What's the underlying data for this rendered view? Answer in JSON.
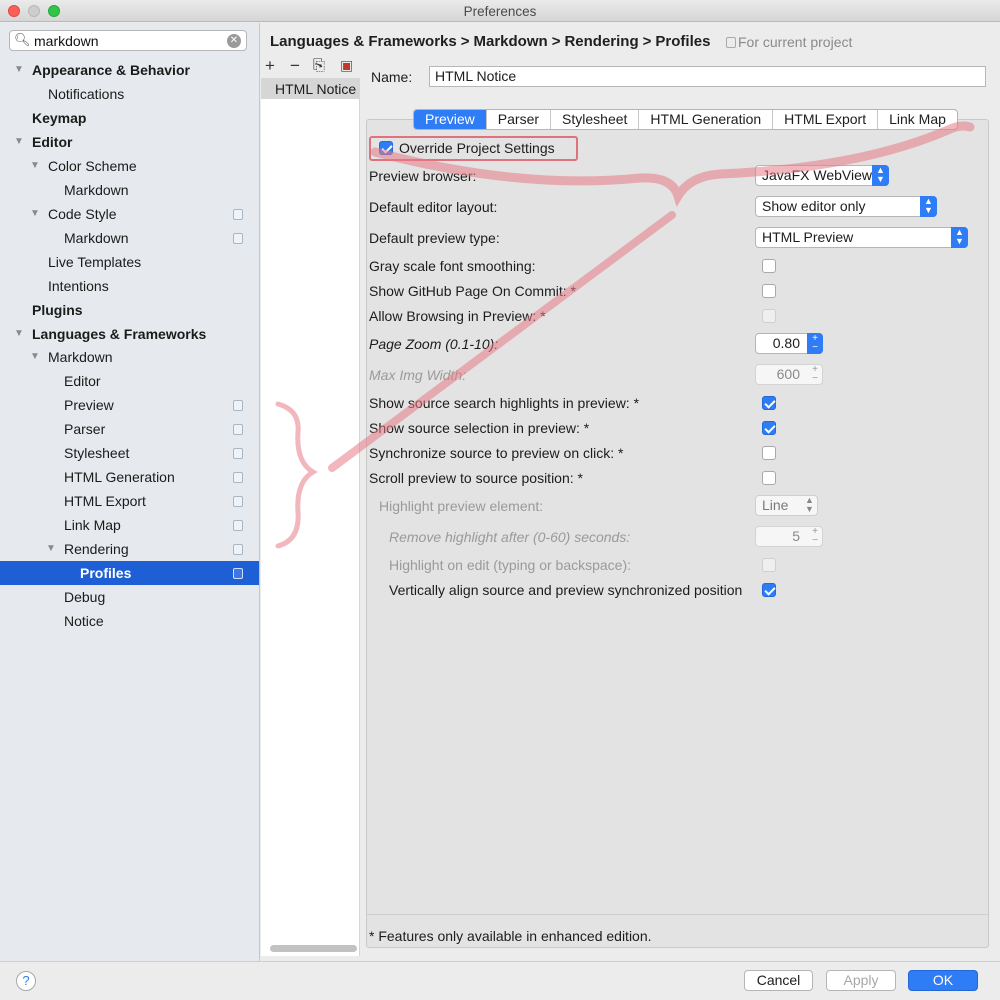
{
  "window": {
    "title": "Preferences"
  },
  "search": {
    "value": "markdown"
  },
  "sidebar": {
    "items": [
      {
        "label": "Appearance & Behavior"
      },
      {
        "label": "Notifications"
      },
      {
        "label": "Keymap"
      },
      {
        "label": "Editor"
      },
      {
        "label": "Color Scheme"
      },
      {
        "label": "Markdown"
      },
      {
        "label": "Code Style"
      },
      {
        "label": "Markdown"
      },
      {
        "label": "Live Templates"
      },
      {
        "label": "Intentions"
      },
      {
        "label": "Plugins"
      },
      {
        "label": "Languages & Frameworks"
      },
      {
        "label": "Markdown"
      },
      {
        "label": "Editor"
      },
      {
        "label": "Preview"
      },
      {
        "label": "Parser"
      },
      {
        "label": "Stylesheet"
      },
      {
        "label": "HTML Generation"
      },
      {
        "label": "HTML Export"
      },
      {
        "label": "Link Map"
      },
      {
        "label": "Rendering"
      },
      {
        "label": "Profiles"
      },
      {
        "label": "Debug"
      },
      {
        "label": "Notice"
      }
    ]
  },
  "breadcrumb": {
    "parts": [
      "Languages & Frameworks",
      "Markdown",
      "Rendering",
      "Profiles"
    ],
    "separator": ">",
    "scope_note": "For current project"
  },
  "profiles": {
    "items": [
      "HTML Notice"
    ]
  },
  "name": {
    "label": "Name:",
    "value": "HTML Notice"
  },
  "tabs": [
    "Preview",
    "Parser",
    "Stylesheet",
    "HTML Generation",
    "HTML Export",
    "Link Map"
  ],
  "active_tab": "Preview",
  "settings": {
    "override": {
      "label": "Override Project Settings",
      "checked": true
    },
    "preview_browser": {
      "label": "Preview browser:",
      "value": "JavaFX WebView"
    },
    "editor_layout": {
      "label": "Default editor layout:",
      "value": "Show editor only"
    },
    "preview_type": {
      "label": "Default preview type:",
      "value": "HTML Preview"
    },
    "gray_scale": {
      "label": "Gray scale font smoothing:",
      "checked": false
    },
    "github_page": {
      "label": "Show GitHub Page On Commit: *",
      "checked": false
    },
    "allow_browsing": {
      "label": "Allow Browsing in Preview: *",
      "checked": false
    },
    "page_zoom": {
      "label": "Page Zoom (0.1-10):",
      "value": "0.80"
    },
    "max_img_width": {
      "label": "Max Img Width:",
      "value": "600"
    },
    "search_highlights": {
      "label": "Show source search highlights in preview: *",
      "checked": true
    },
    "source_selection": {
      "label": "Show source selection in preview: *",
      "checked": true
    },
    "sync_on_click": {
      "label": "Synchronize source to preview on click: *",
      "checked": false
    },
    "scroll_preview": {
      "label": "Scroll preview to source position: *",
      "checked": false
    },
    "highlight_element": {
      "label": "Highlight preview element:",
      "value": "Line"
    },
    "remove_highlight": {
      "label": "Remove highlight after (0-60) seconds:",
      "value": "5"
    },
    "highlight_on_edit": {
      "label": "Highlight on edit (typing or backspace):",
      "checked": false
    },
    "vertically_align": {
      "label": "Vertically align source and preview synchronized position",
      "checked": true
    }
  },
  "footer_note": "* Features only available in enhanced edition.",
  "buttons": {
    "help": "?",
    "cancel": "Cancel",
    "apply": "Apply",
    "ok": "OK"
  },
  "colors": {
    "accent": "#2e7cf6",
    "selection": "#1e5fd5",
    "annotation": "#e87a86"
  }
}
